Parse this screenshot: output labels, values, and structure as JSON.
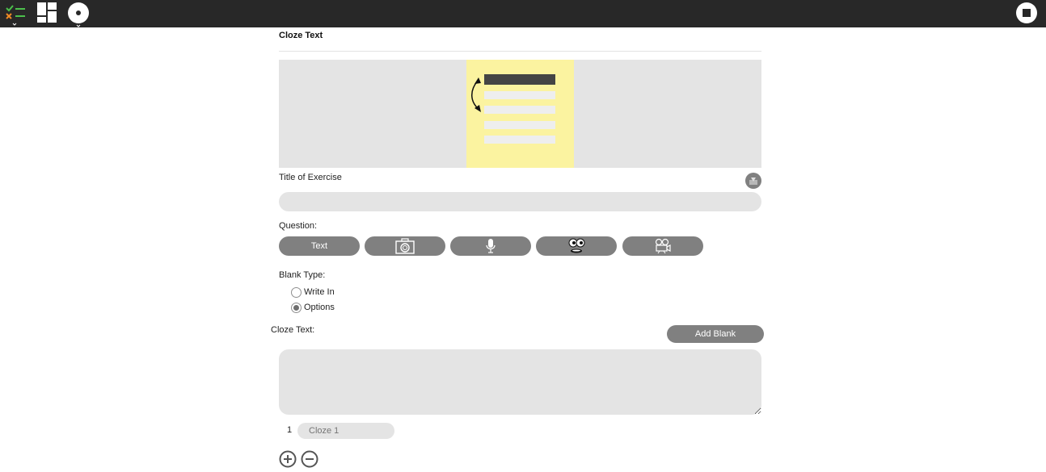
{
  "toolbar": {
    "icons": [
      "checklist-icon",
      "layout-grid-icon",
      "disc-icon",
      "stop-icon"
    ]
  },
  "exercise": {
    "section_title": "Cloze Text",
    "title_label": "Title of Exercise",
    "title_value": "",
    "question_label": "Question:",
    "question_buttons": [
      {
        "label": "Text",
        "icon": "text"
      },
      {
        "label": "",
        "icon": "camera-icon"
      },
      {
        "label": "",
        "icon": "microphone-icon"
      },
      {
        "label": "",
        "icon": "face-icon"
      },
      {
        "label": "",
        "icon": "video-camera-icon"
      }
    ],
    "blank_type_label": "Blank Type:",
    "blank_types": [
      {
        "label": "Write In",
        "checked": false
      },
      {
        "label": "Options",
        "checked": true
      }
    ],
    "cloze_text_label": "Cloze Text:",
    "add_blank_label": "Add Blank",
    "cloze_text_value": "",
    "cloze_items": [
      {
        "number": "1",
        "placeholder": "Cloze 1"
      }
    ]
  },
  "colors": {
    "toolbar_bg": "#282828",
    "button_bg": "#808080",
    "field_bg": "#e4e4e4",
    "preview_card": "#fbf3a0"
  }
}
